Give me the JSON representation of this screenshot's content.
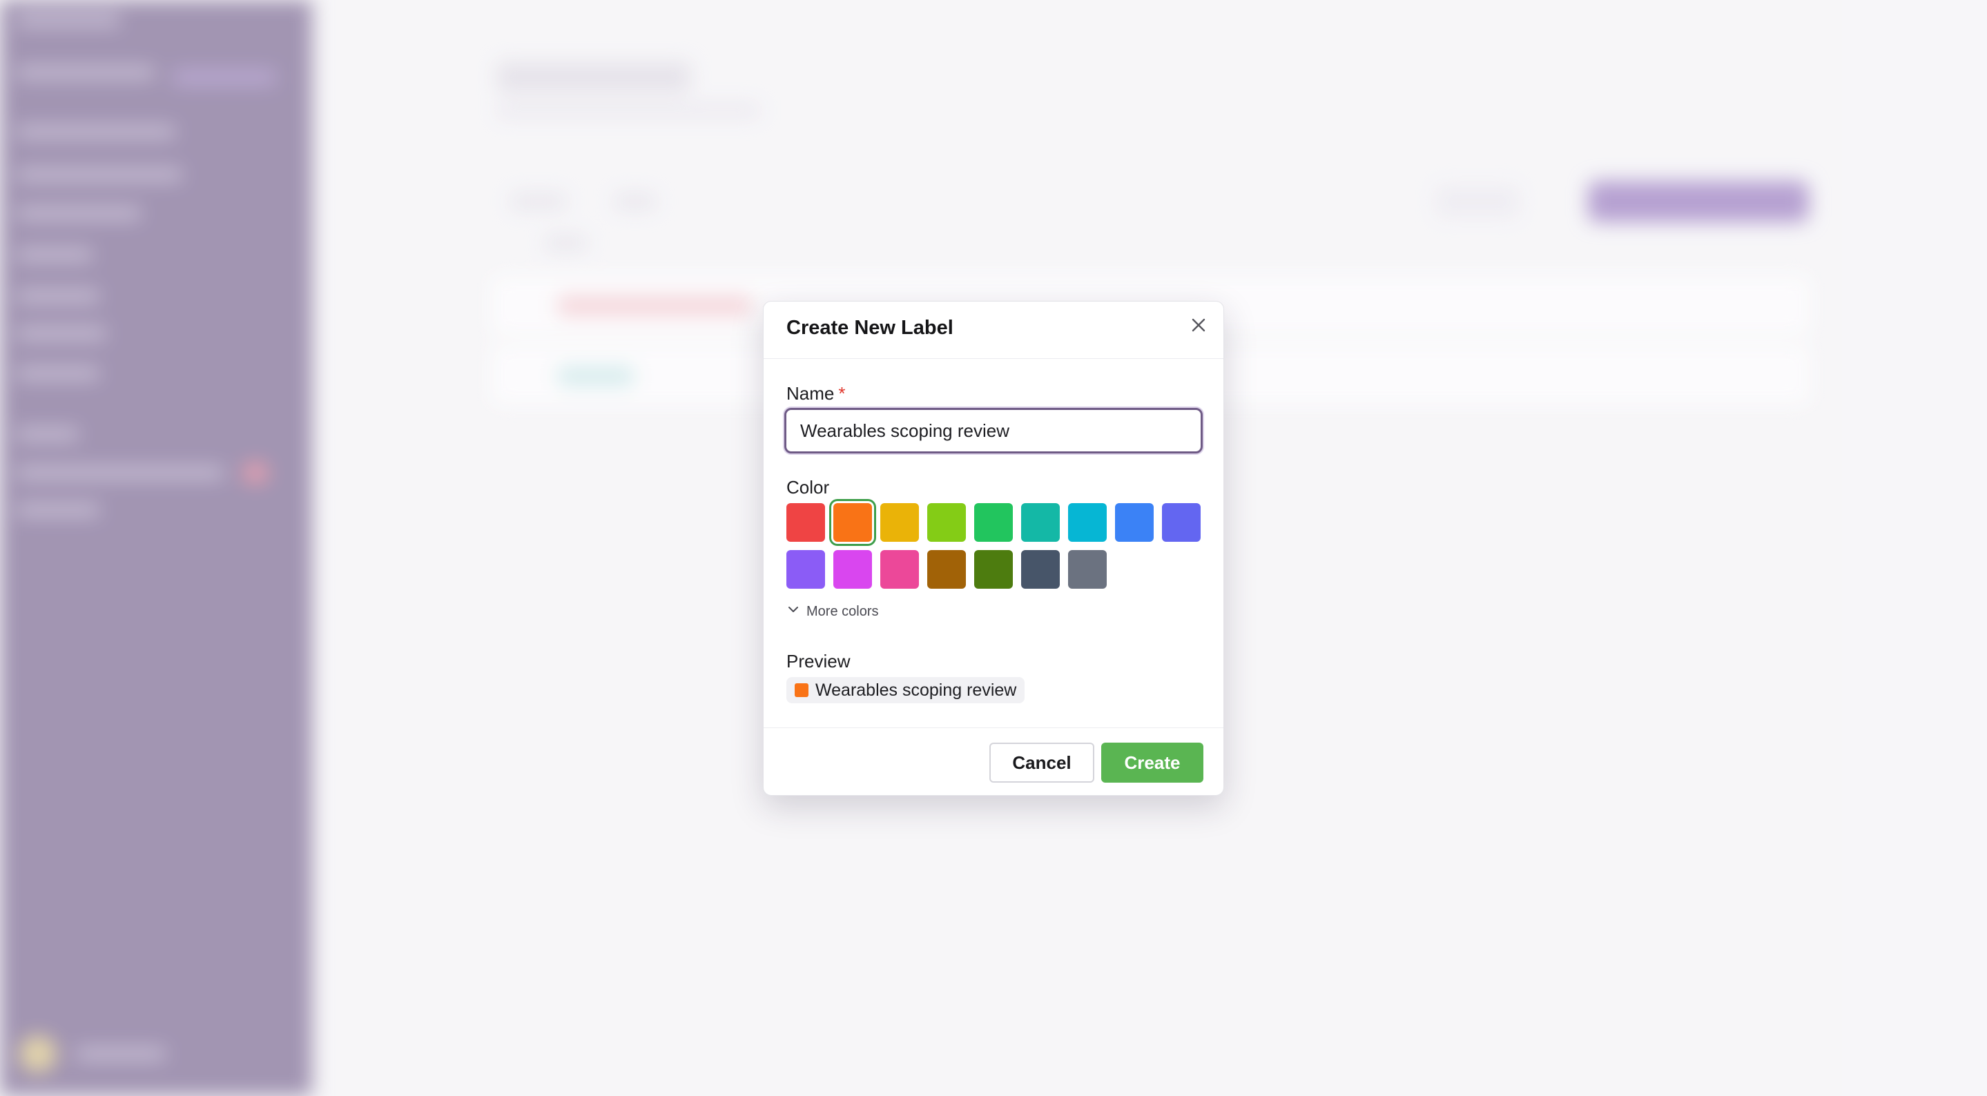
{
  "modal": {
    "title": "Create New Label",
    "name_label": "Name",
    "required_marker": "*",
    "name_value": "Wearables scoping review",
    "color_label": "Color",
    "selected_color": "#f97316",
    "swatches": [
      "#ef4444",
      "#f97316",
      "#eab308",
      "#84cc16",
      "#22c55e",
      "#14b8a6",
      "#06b6d4",
      "#3b82f6",
      "#6366f1",
      "#8b5cf6",
      "#d946ef",
      "#ec4899",
      "#a16207",
      "#4d7c0f",
      "#475569",
      "#6b7280"
    ],
    "more_colors_label": "More colors",
    "preview_label": "Preview",
    "preview_text": "Wearables scoping review",
    "cancel_label": "Cancel",
    "create_label": "Create",
    "create_color": "#5ab552"
  },
  "icons": {
    "close": "close-icon",
    "chevron": "chevron-down-icon"
  }
}
